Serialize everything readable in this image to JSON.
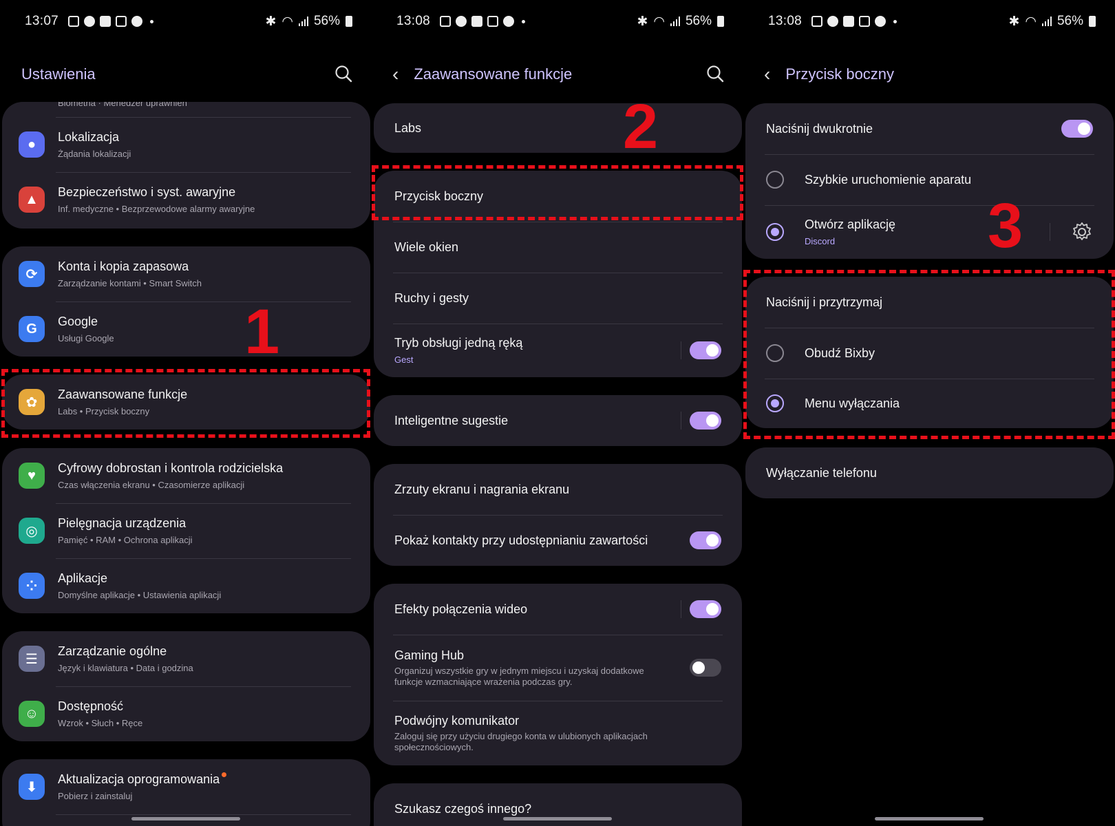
{
  "status_bars": [
    {
      "time": "13:07",
      "battery": "56%"
    },
    {
      "time": "13:08",
      "battery": "56%"
    },
    {
      "time": "13:08",
      "battery": "56%"
    }
  ],
  "panel1": {
    "title": "Ustawienia",
    "cropped_label": "Biometria · Menedżer uprawnień",
    "items": [
      {
        "label": "Lokalizacja",
        "sub": "Żądania lokalizacji",
        "icon": "location-icon",
        "color": "#5b6cf0"
      },
      {
        "label": "Bezpieczeństwo i syst. awaryjne",
        "sub": "Inf. medyczne  •  Bezprzewodowe alarmy awaryjne",
        "icon": "emergency-icon",
        "color": "#d9423b"
      },
      {
        "label": "Konta i kopia zapasowa",
        "sub": "Zarządzanie kontami  •  Smart Switch",
        "icon": "sync-icon",
        "color": "#3c7bf0"
      },
      {
        "label": "Google",
        "sub": "Usługi Google",
        "icon": "google-icon",
        "color": "#3c7bf0"
      },
      {
        "label": "Zaawansowane funkcje",
        "sub": "Labs  •  Przycisk boczny",
        "icon": "advanced-features-icon",
        "color": "#e5a73a"
      },
      {
        "label": "Cyfrowy dobrostan i kontrola rodzicielska",
        "sub": "Czas włączenia ekranu  •  Czasomierze aplikacji",
        "icon": "wellbeing-icon",
        "color": "#3fae4a"
      },
      {
        "label": "Pielęgnacja urządzenia",
        "sub": "Pamięć  •  RAM  •  Ochrona aplikacji",
        "icon": "device-care-icon",
        "color": "#1fa98e"
      },
      {
        "label": "Aplikacje",
        "sub": "Domyślne aplikacje  •  Ustawienia aplikacji",
        "icon": "apps-icon",
        "color": "#3c7bf0"
      },
      {
        "label": "Zarządzanie ogólne",
        "sub": "Język i klawiatura  •  Data i godzina",
        "icon": "general-management-icon",
        "color": "#6a6f92"
      },
      {
        "label": "Dostępność",
        "sub": "Wzrok  •  Słuch  •  Ręce",
        "icon": "accessibility-icon",
        "color": "#3fae4a"
      },
      {
        "label": "Aktualizacja oprogramowania",
        "sub": "Pobierz i zainstaluj",
        "icon": "software-update-icon",
        "color": "#3c7bf0"
      }
    ],
    "annotation": "1"
  },
  "panel2": {
    "title": "Zaawansowane funkcje",
    "items": [
      {
        "label": "Labs"
      },
      {
        "label": "Przycisk boczny"
      },
      {
        "label": "Wiele okien"
      },
      {
        "label": "Ruchy i gesty"
      },
      {
        "label": "Tryb obsługi jedną ręką",
        "sub": "Gest",
        "toggle": true
      },
      {
        "label": "Inteligentne sugestie",
        "toggle": true
      },
      {
        "label": "Zrzuty ekranu i nagrania ekranu"
      },
      {
        "label": "Pokaż kontakty przy udostępnianiu zawartości",
        "toggle": true
      },
      {
        "label": "Efekty połączenia wideo",
        "toggle": true
      },
      {
        "label": "Gaming Hub",
        "sub": "Organizuj wszystkie gry w jednym miejscu i uzyskaj dodatkowe funkcje wzmacniające wrażenia podczas gry.",
        "toggle": false
      },
      {
        "label": "Podwójny komunikator",
        "sub": "Zaloguj się przy użyciu drugiego konta w ulubionych aplikacjach społecznościowych."
      },
      {
        "label": "Szukasz czegoś innego?"
      }
    ],
    "annotation": "2"
  },
  "panel3": {
    "title": "Przycisk boczny",
    "double_press": {
      "label": "Naciśnij dwukrotnie",
      "toggle": true
    },
    "double_options": [
      {
        "label": "Szybkie uruchomienie aparatu",
        "selected": false
      },
      {
        "label": "Otwórz aplikację",
        "sub": "Discord",
        "selected": true
      }
    ],
    "hold_press": {
      "label": "Naciśnij i przytrzymaj"
    },
    "hold_options": [
      {
        "label": "Obudź Bixby",
        "selected": false
      },
      {
        "label": "Menu wyłączania",
        "selected": true
      }
    ],
    "power_off": {
      "label": "Wyłączanie telefonu"
    },
    "annotation": "3"
  },
  "colors": {
    "accent": "#b996f3",
    "card": "#221f29",
    "annotation": "#e8101a",
    "title": "#cfc4ff"
  }
}
